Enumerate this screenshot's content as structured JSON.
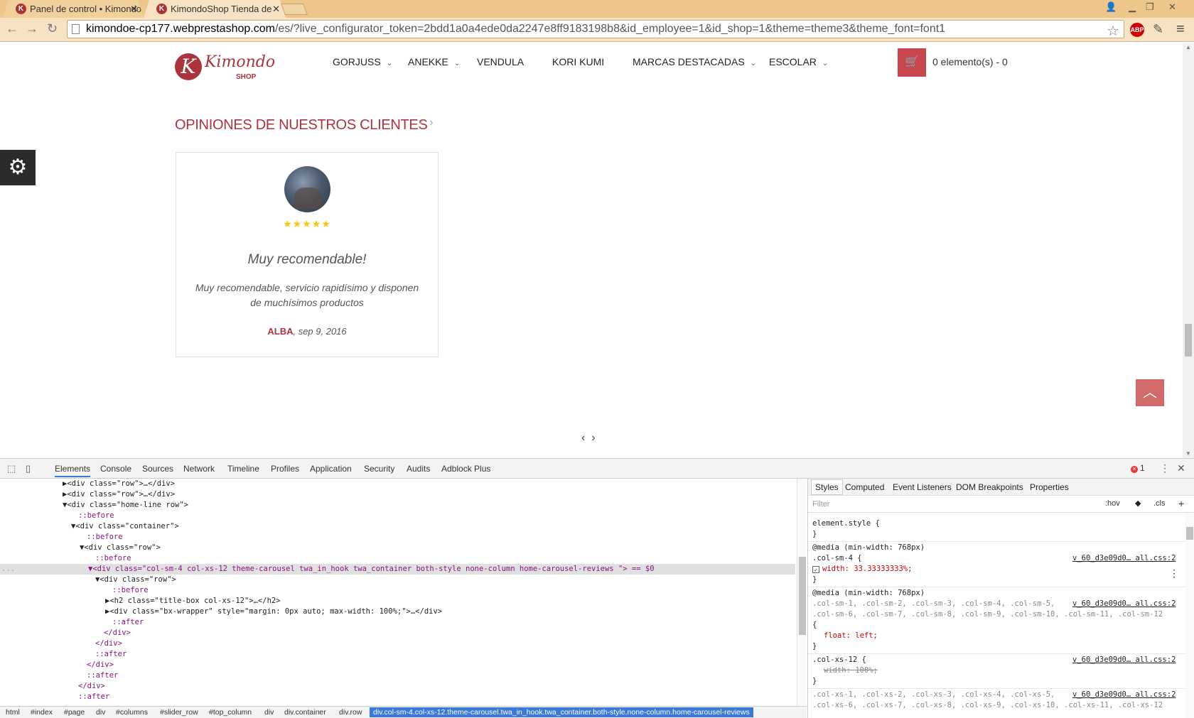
{
  "browser": {
    "tabs": [
      {
        "title": "Panel de control • Kimondo"
      },
      {
        "title": "KimondoShop Tienda de"
      }
    ],
    "url_host": "kimondoe-cp177.webprestashop.com",
    "url_rest": "/es/?live_configurator_token=2bdd1a0a4ede0da2247e8ff9183198b8&id_employee=1&id_shop=1&theme=theme3&theme_font=font1",
    "abp": "ABP"
  },
  "site": {
    "logo_name": "Kimondo",
    "logo_shop": "SHOP",
    "logo_letter": "K",
    "nav": [
      {
        "label": "GORJUSS",
        "caret": "⌄"
      },
      {
        "label": "ANEKKE",
        "caret": "⌄"
      },
      {
        "label": "VENDULA",
        "caret": ""
      },
      {
        "label": "KORI KUMI",
        "caret": ""
      },
      {
        "label": "MARCAS DESTACADAS",
        "caret": "⌄"
      },
      {
        "label": "ESCOLAR",
        "caret": "⌄"
      }
    ],
    "cart_label": "0 elemento(s) - 0",
    "section_title": "OPINIONES DE NUESTROS CLIENTES",
    "review": {
      "rating": 5,
      "stars": "★★★★★",
      "title": "Muy recomendable!",
      "text": "Muy recomendable, servicio rapidísimo y disponen de muchísimos productos",
      "author": "ALBA",
      "date": ", sep 9, 2016"
    }
  },
  "devtools": {
    "tabs": [
      "Elements",
      "Console",
      "Sources",
      "Network",
      "Timeline",
      "Profiles",
      "Application",
      "Security",
      "Audits",
      "Adblock Plus"
    ],
    "active_tab": "Elements",
    "error_count": "1",
    "tree": [
      "▶<div class=\"row\">…</div>",
      "▶<div class=\"row\">…</div>",
      "▼<div class=\"home-line row\">",
      "::before",
      "▼<div class=\"container\">",
      "::before",
      "▼<div class=\"row\">",
      "::before",
      "▼<div class=\"col-sm-4 col-xs-12 theme-carousel twa_in_hook twa_container both-style none-column home-carousel-reviews \"> == $0",
      "▼<div class=\"row\">",
      "::before",
      "▶<h2 class=\"title-box col-xs-12\">…</h2>",
      "▶<div class=\"bx-wrapper\" style=\"margin: 0px auto; max-width: 100%;\">…</div>",
      "::after",
      "</div>",
      "</div>",
      "::after",
      "</div>",
      "::after",
      "</div>",
      "::after"
    ],
    "selected_index": 8,
    "selection_dots": "...",
    "breadcrumb": [
      "html",
      "#index",
      "#page",
      "div",
      "#columns",
      "#slider_row",
      "#top_column",
      "div",
      "div.container",
      "div.row",
      "div.col-sm-4.col-xs-12.theme-carousel.twa_in_hook.twa_container.both-style.none-column.home-carousel-reviews"
    ],
    "styles_tabs": [
      "Styles",
      "Computed",
      "Event Listeners",
      "DOM Breakpoints",
      "Properties"
    ],
    "filter_placeholder": "Filter",
    "hov": ":hov",
    "cls": ".cls",
    "plus": "+",
    "rules": {
      "r1a": "element.style {",
      "r1b": "}",
      "r2a": "@media (min-width: 768px)",
      "r2b": ".col-sm-4 {",
      "r2c": "width: 33.33333333%;",
      "r2d": "}",
      "r2src": "v_60_d3e09d0… all.css:2",
      "r3a": "@media (min-width: 768px)",
      "r3b": ".col-sm-1, .col-sm-2, .col-sm-3, .col-sm-4, .col-sm-5,",
      "r3c": ".col-sm-6, .col-sm-7, .col-sm-8, .col-sm-9, .col-sm-10, .col-sm-11, .col-sm-12",
      "r3d": "{",
      "r3e": "float: left;",
      "r3f": "}",
      "r3src": "v_60_d3e09d0… all.css:2",
      "r4a": ".col-xs-12 {",
      "r4b": "width: 100%;",
      "r4c": "}",
      "r4src": "v_60_d3e09d0… all.css:2",
      "r5a": ".col-xs-1, .col-xs-2, .col-xs-3, .col-xs-4, .col-xs-5,",
      "r5b": ".col-xs-6, .col-xs-7, .col-xs-8, .col-xs-9, .col-xs-10, .col-xs-11, .col-xs-12",
      "r5src": "v_60_d3e09d0… all.css:2"
    }
  }
}
